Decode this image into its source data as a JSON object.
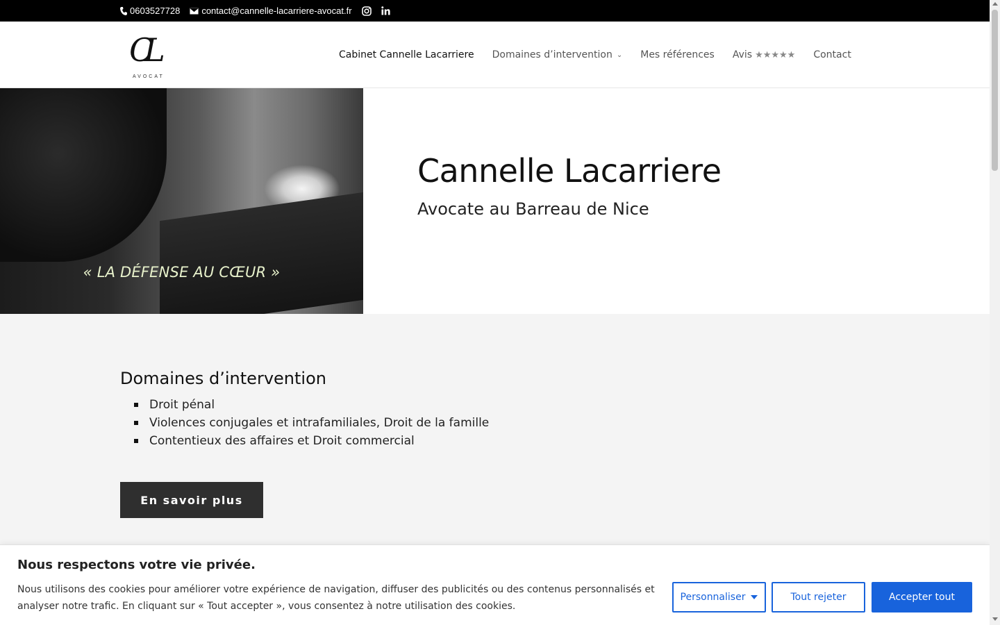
{
  "topbar": {
    "phone": "0603527728",
    "email": "contact@cannelle-lacarriere-avocat.fr",
    "phone_icon": "phone-icon",
    "email_icon": "envelope-icon",
    "social": [
      "instagram-icon",
      "linkedin-icon"
    ]
  },
  "header": {
    "logo_monogram": "CL",
    "logo_subtitle": "AVOCAT",
    "nav": [
      {
        "label": "Cabinet Cannelle Lacarriere",
        "active": true
      },
      {
        "label": "Domaines d’intervention",
        "dropdown": true
      },
      {
        "label": "Mes références"
      },
      {
        "label": "Avis",
        "stars": "★★★★★"
      },
      {
        "label": "Contact"
      }
    ]
  },
  "hero": {
    "quote": "« LA DÉFENSE AU CŒUR »",
    "title": "Cannelle Lacarriere",
    "subtitle": "Avocate au Barreau de Nice"
  },
  "domains": {
    "heading": "Domaines d’intervention",
    "items": [
      "Droit pénal",
      "Violences conjugales et intrafamiliales, Droit de la famille",
      "Contentieux des affaires et Droit commercial"
    ],
    "button": "En savoir plus"
  },
  "cookie": {
    "title": "Nous respectons votre vie privée.",
    "text": "Nous utilisons des cookies pour améliorer votre expérience de navigation, diffuser des publicités ou des contenus personnalisés et analyser notre trafic. En cliquant sur « Tout accepter », vous consentez à notre utilisation des cookies.",
    "customize": "Personnaliser",
    "reject": "Tout rejeter",
    "accept": "Accepter tout"
  },
  "colors": {
    "topbar_bg": "#000000",
    "accent_blue": "#1863dc",
    "section_bg": "#f4f4f4",
    "button_dark": "#2f2f2f"
  }
}
